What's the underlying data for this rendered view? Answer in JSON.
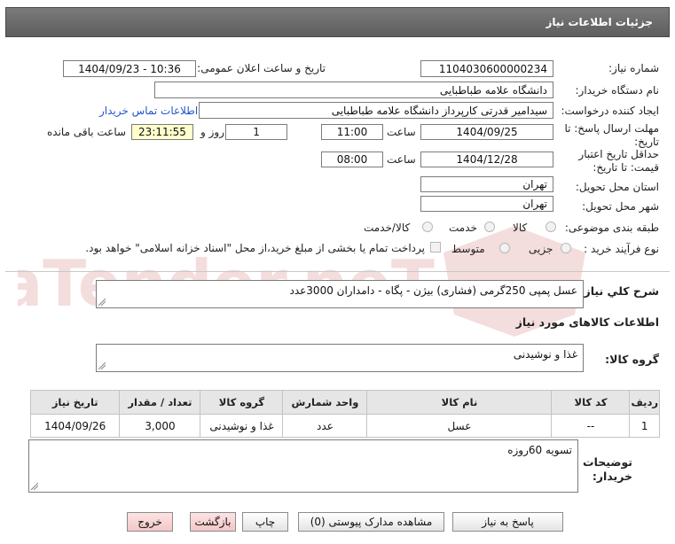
{
  "header": {
    "title": "جزئیات اطلاعات نیاز"
  },
  "fields": {
    "need_number_label": "شماره نیاز:",
    "need_number": "1104030600000234",
    "announce_label": "تاریخ و ساعت اعلان عمومی:",
    "announce_value": "1404/09/23 - 10:36",
    "buyer_org_label": "نام دستگاه خریدار:",
    "buyer_org": "دانشگاه علامه طباطبایی",
    "creator_label": "ایجاد کننده درخواست:",
    "creator": "سیدامیر قدرتی کارپرداز دانشگاه علامه طباطبایی",
    "contact_link": "اطلاعات تماس خریدار",
    "deadline_label_1": "مهلت ارسال پاسخ: تا",
    "deadline_label_2": "تاریخ:",
    "deadline_date": "1404/09/25",
    "time_label": "ساعت",
    "deadline_time": "11:00",
    "days_value": "1",
    "days_label": "روز و",
    "remaining_value": "23:11:55",
    "remaining_label": "ساعت باقی مانده",
    "validity_label_1": "حداقل تاریخ اعتبار",
    "validity_label_2": "قیمت: تا تاریخ:",
    "validity_date": "1404/12/28",
    "validity_time": "08:00",
    "province_label": "استان محل تحویل:",
    "province": "تهران",
    "city_label": "شهر محل تحویل:",
    "city": "تهران",
    "category_label": "طبقه بندی موضوعی:",
    "category_options": [
      "کالا",
      "خدمت",
      "کالا/خدمت"
    ],
    "process_label": "نوع فرآیند خرید :",
    "process_options": [
      "جزیی",
      "متوسط"
    ],
    "payment_note": "پرداخت تمام یا بخشی از مبلغ خرید،از محل \"اسناد خزانه اسلامی\" خواهد بود."
  },
  "description": {
    "label": "شرح كلي نياز:",
    "value": "عسل پمپی 250گرمی (فشاری) بیژن - پگاه - دامداران 3000عدد"
  },
  "goods_section": {
    "title": "اطلاعات کالاهای مورد نیاز"
  },
  "goods_group": {
    "label": "گروه کالا:",
    "value": "غذا و نوشیدنی"
  },
  "table": {
    "headers": [
      "ردیف",
      "کد کالا",
      "نام کالا",
      "واحد شمارش",
      "گروه کالا",
      "تعداد / مقدار",
      "تاریخ نیاز"
    ],
    "rows": [
      [
        "1",
        "--",
        "عسل",
        "عدد",
        "غذا و نوشیدنی",
        "3,000",
        "1404/09/26"
      ]
    ]
  },
  "buyer_notes": {
    "label_1": "توضیحات",
    "label_2": "خریدار:",
    "value": "تسویه 60روزه"
  },
  "buttons": {
    "reply": "پاسخ به نیاز",
    "attachments": "مشاهده مدارک پیوستی (0)",
    "print": "چاپ",
    "back": "بازگشت",
    "exit": "خروج"
  },
  "watermark": {
    "text": "AriaTender.neT"
  },
  "colors": {
    "header_bg": "#6b6b6b",
    "link": "#2255cc",
    "remaining_bg": "#ffffcc",
    "exit_bg": "#f7d4d4"
  }
}
